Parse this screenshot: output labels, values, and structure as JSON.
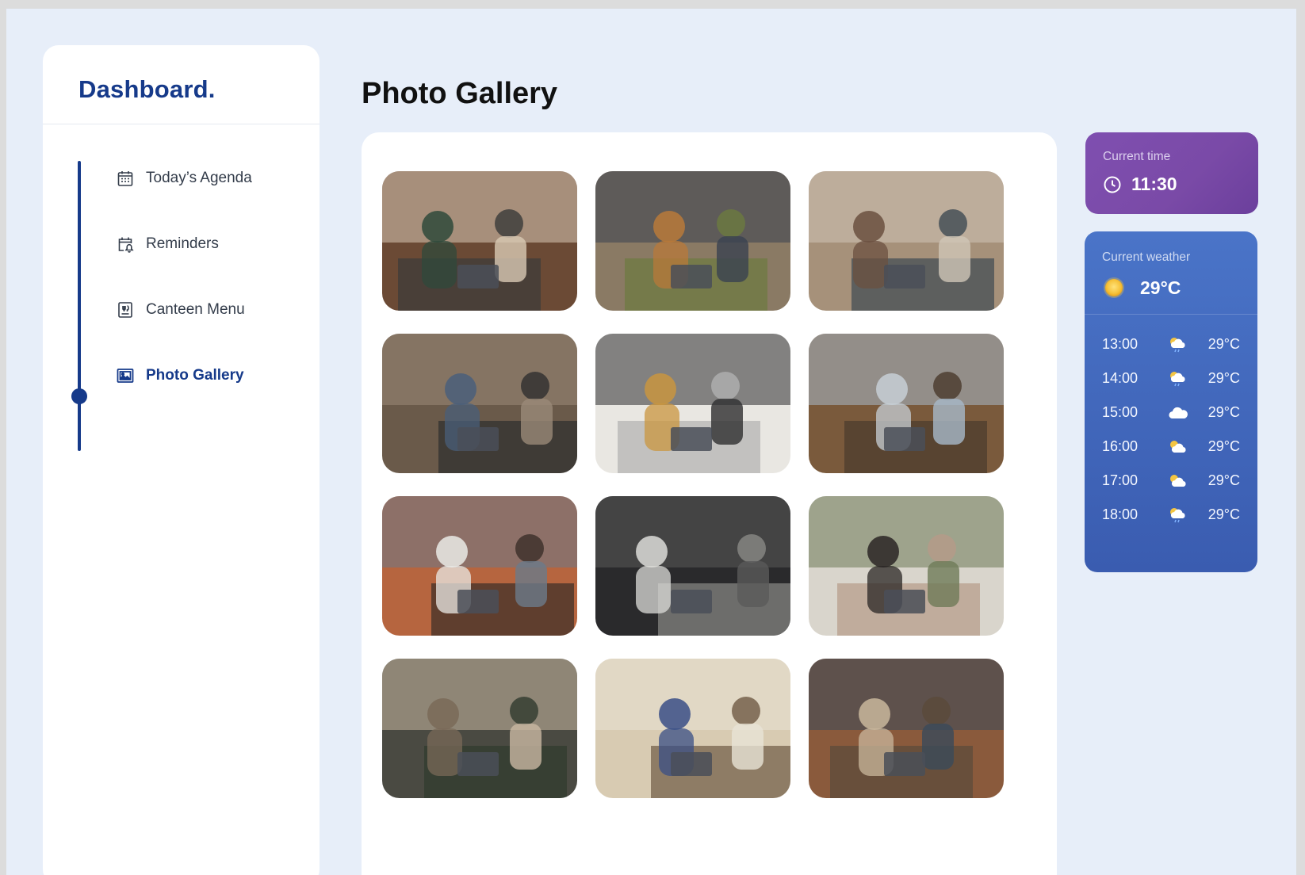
{
  "sidebar": {
    "brand": "Dashboard.",
    "items": [
      {
        "label": "Today’s Agenda",
        "icon": "calendar-icon",
        "active": false
      },
      {
        "label": "Reminders",
        "icon": "reminder-icon",
        "active": false
      },
      {
        "label": "Canteen Menu",
        "icon": "menu-icon",
        "active": false
      },
      {
        "label": "Photo Gallery",
        "icon": "gallery-icon",
        "active": true
      }
    ]
  },
  "main": {
    "title": "Photo Gallery",
    "photos": [
      {
        "name": "photo-1"
      },
      {
        "name": "photo-2"
      },
      {
        "name": "photo-3"
      },
      {
        "name": "photo-4"
      },
      {
        "name": "photo-5"
      },
      {
        "name": "photo-6"
      },
      {
        "name": "photo-7"
      },
      {
        "name": "photo-8"
      },
      {
        "name": "photo-9"
      },
      {
        "name": "photo-10"
      },
      {
        "name": "photo-11"
      },
      {
        "name": "photo-12"
      }
    ]
  },
  "time_widget": {
    "label": "Current time",
    "value": "11:30",
    "icon": "clock-icon"
  },
  "weather_widget": {
    "label": "Current weather",
    "temperature": "29°C",
    "icon": "sun-icon",
    "forecast": [
      {
        "time": "13:00",
        "icon": "rain-cloud-icon",
        "temp": "29°C"
      },
      {
        "time": "14:00",
        "icon": "rain-cloud-icon",
        "temp": "29°C"
      },
      {
        "time": "15:00",
        "icon": "cloud-icon",
        "temp": "29°C"
      },
      {
        "time": "16:00",
        "icon": "partly-cloudy-icon",
        "temp": "29°C"
      },
      {
        "time": "17:00",
        "icon": "partly-cloudy-icon",
        "temp": "29°C"
      },
      {
        "time": "18:00",
        "icon": "rain-cloud-icon",
        "temp": "29°C"
      }
    ]
  },
  "colors": {
    "accent": "#163a8a",
    "background": "#e7eef9",
    "time_card": "#7a4aa7",
    "weather_card": "#3f63b8"
  }
}
